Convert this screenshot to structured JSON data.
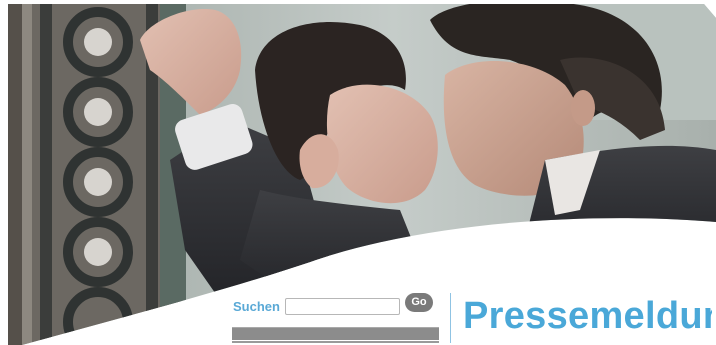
{
  "hero": {
    "image_alt": "Film still: couple in rain beside an ornate iron gate"
  },
  "search": {
    "label": "Suchen",
    "value": "",
    "placeholder": "",
    "go_label": "Go"
  },
  "header": {
    "title": "Pressemeldun"
  },
  "colors": {
    "accent": "#4aa8d8",
    "search_label": "#5aa9d6",
    "go_button": "#7a7a7a",
    "underbar": "#8c8c8c"
  }
}
